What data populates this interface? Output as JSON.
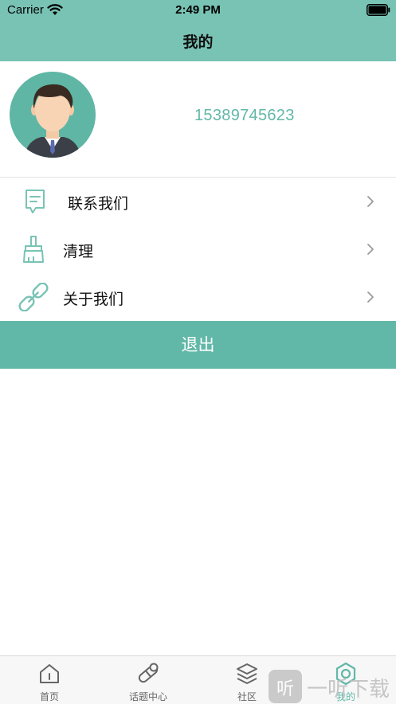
{
  "status_bar": {
    "carrier": "Carrier",
    "time": "2:49 PM"
  },
  "nav": {
    "title": "我的"
  },
  "profile": {
    "phone": "15389745623"
  },
  "menu": [
    {
      "label": "联系我们",
      "icon": "message-icon"
    },
    {
      "label": "清理",
      "icon": "broom-icon"
    },
    {
      "label": "关于我们",
      "icon": "link-icon"
    }
  ],
  "logout_label": "退出",
  "tabbar": [
    {
      "label": "首页",
      "icon": "home-icon",
      "active": false
    },
    {
      "label": "话题中心",
      "icon": "topic-icon",
      "active": false
    },
    {
      "label": "社区",
      "icon": "layers-icon",
      "active": false
    },
    {
      "label": "我的",
      "icon": "hex-nut-icon",
      "active": true
    }
  ],
  "watermark": {
    "glyph": "听",
    "text": "一听下载"
  },
  "colors": {
    "header": "#79c3b5",
    "accent": "#62b8a8",
    "tabbar_bg": "#f7f7f7"
  }
}
